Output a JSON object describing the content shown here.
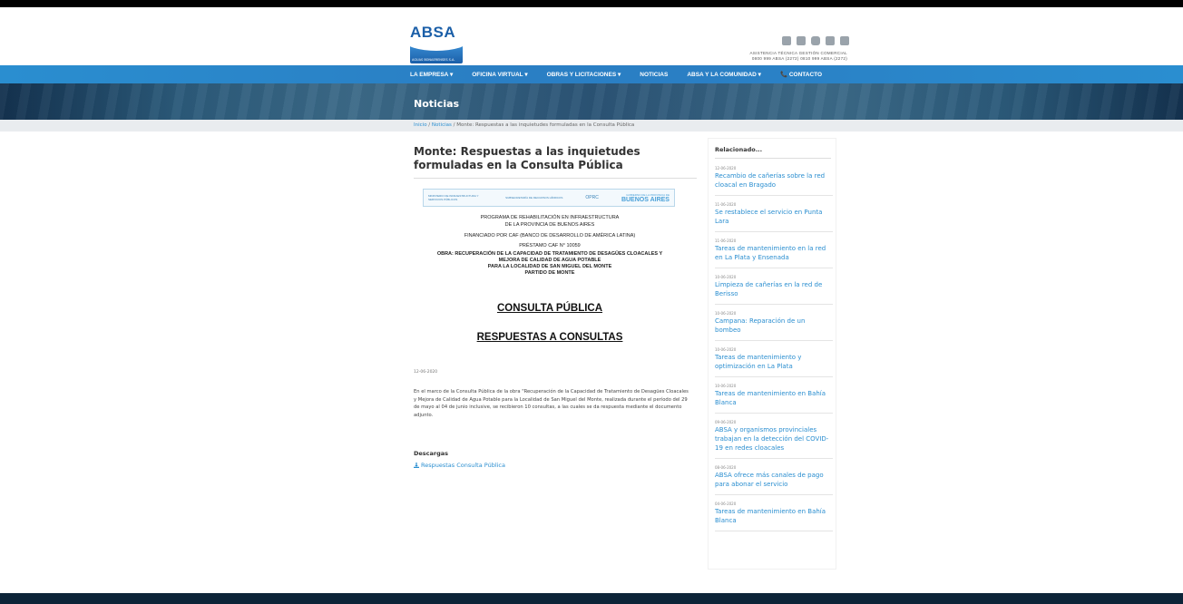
{
  "header": {
    "logo_text": "ABSA",
    "logo_subtext": "AGUAS BONAERENSES S.A.",
    "contact_line1": "ASISTENCIA TÉCNICA   GESTIÓN COMERCIAL",
    "contact_line2": "0800 999 ABSA (2272)   0810 999 ABSA (2272)",
    "social_icons": [
      "facebook-icon",
      "youtube-icon",
      "instagram-icon",
      "twitter-icon",
      "linkedin-icon"
    ]
  },
  "nav": {
    "items": [
      {
        "label": "LA EMPRESA ▾"
      },
      {
        "label": "OFICINA VIRTUAL ▾"
      },
      {
        "label": "OBRAS Y LICITACIONES ▾"
      },
      {
        "label": "NOTICIAS"
      },
      {
        "label": "ABSA Y LA COMUNIDAD ▾"
      },
      {
        "label": "📞 CONTACTO"
      }
    ]
  },
  "hero": {
    "title": "Noticias"
  },
  "breadcrumb": {
    "home": "Inicio",
    "sep": " / ",
    "section": "Noticias",
    "current": "Monte: Respuestas a las inquietudes formuladas en la Consulta Pública"
  },
  "article": {
    "title": "Monte: Respuestas a las inquietudes formuladas en la Consulta Pública",
    "doc": {
      "header_left": "MINISTERIO DE INFRAESTRUCTURA Y SERVICIOS PÚBLICOS",
      "header_mid": "SUBSECRETARÍA DE RECURSOS HÍDRICOS",
      "header_mid2": "OPRC",
      "header_right_small": "GOBIERNO DE LA PROVINCIA DE",
      "header_right": "BUENOS AIRES",
      "line1": "PROGRAMA DE REHABILITACIÓN EN INFRAESTRUCTURA",
      "line2": "DE LA PROVINCIA DE BUENOS AIRES",
      "line3": "FINANCIADO POR CAF (BANCO DE DESARROLLO DE AMÉRICA LATINA)",
      "line4": "PRÉSTAMO CAF N° 10059",
      "bold1": "OBRA: RECUPERACIÓN DE LA CAPACIDAD DE TRATAMIENTO DE DESAGÜES CLOACALES Y",
      "bold2": "MEJORA DE CALIDAD DE AGUA POTABLE",
      "bold3": "PARA LA LOCALIDAD DE SAN MIGUEL DEL MONTE",
      "bold4": "PARTIDO DE MONTE",
      "big1": "CONSULTA PÚBLICA",
      "big2": "RESPUESTAS A CONSULTAS"
    },
    "date": "12-06-2020",
    "body": "En el marco de la Consulta Pública de la obra \"Recuperación de la Capacidad de Tratamiento de Desagües Cloacales y Mejora de Calidad de Agua Potable para la Localidad de San Miguel del Monte, realizada durante el período del 29 de mayo al 04 de junio inclusive, se recibieron 10 consultas, a las cuales se da respuesta mediante el documento adjunto.",
    "downloads_heading": "Descargas",
    "download_label": "Respuestas Consulta Pública"
  },
  "sidebar": {
    "heading": "Relacionado...",
    "items": [
      {
        "date": "12-06-2020",
        "title": "Recambio de cañerías sobre la red cloacal en Bragado"
      },
      {
        "date": "11-06-2020",
        "title": "Se restablece el servicio en Punta Lara"
      },
      {
        "date": "11-06-2020",
        "title": "Tareas de mantenimiento en la red en La Plata y Ensenada"
      },
      {
        "date": "10-06-2020",
        "title": "Limpieza de cañerías en la red de Berisso"
      },
      {
        "date": "10-06-2020",
        "title": "Campana: Reparación de un bombeo"
      },
      {
        "date": "10-06-2020",
        "title": "Tareas de mantenimiento y optimización en La Plata"
      },
      {
        "date": "10-06-2020",
        "title": "Tareas de mantenimiento en Bahía Blanca"
      },
      {
        "date": "09-06-2020",
        "title": "ABSA y organismos provinciales trabajan en la detección del COVID-19 en redes cloacales"
      },
      {
        "date": "08-06-2020",
        "title": "ABSA ofrece más canales de pago para abonar el servicio"
      },
      {
        "date": "04-06-2020",
        "title": "Tareas de mantenimiento en Bahía Blanca"
      }
    ]
  },
  "colors": {
    "accent": "#2a8ed0",
    "brand": "#1b5fa8",
    "footer": "#0d2438"
  }
}
